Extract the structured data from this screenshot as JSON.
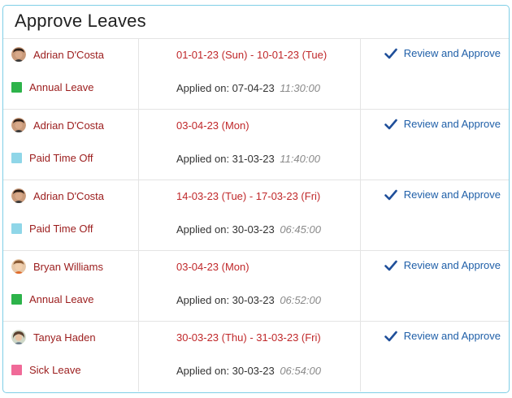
{
  "panel": {
    "title": "Approve Leaves"
  },
  "colors": {
    "annual_leave": "#2db34a",
    "paid_time_off": "#8fd6e8",
    "sick_leave": "#f06a98",
    "name_text": "#9b1c1c",
    "date_text": "#c0282a",
    "link_text": "#1f5fa8",
    "border": "#7fcfe6"
  },
  "leaves": [
    {
      "employee": "Adrian D'Costa",
      "avatar_icon": "avatar-dark-hair",
      "type": "Annual Leave",
      "type_color": "#2db34a",
      "dates": "01-01-23 (Sun) - 10-01-23 (Tue)",
      "applied_label": "Applied on: 07-04-23",
      "applied_time": "11:30:00",
      "action": "Review and Approve"
    },
    {
      "employee": "Adrian D'Costa",
      "avatar_icon": "avatar-dark-hair",
      "type": "Paid Time Off",
      "type_color": "#8fd6e8",
      "dates": "03-04-23 (Mon)",
      "applied_label": "Applied on: 31-03-23",
      "applied_time": "11:40:00",
      "action": "Review and Approve"
    },
    {
      "employee": "Adrian D'Costa",
      "avatar_icon": "avatar-dark-hair",
      "type": "Paid Time Off",
      "type_color": "#8fd6e8",
      "dates": "14-03-23 (Tue) - 17-03-23 (Fri)",
      "applied_label": "Applied on: 30-03-23",
      "applied_time": "06:45:00",
      "action": "Review and Approve"
    },
    {
      "employee": "Bryan Williams",
      "avatar_icon": "avatar-light-hair",
      "type": "Annual Leave",
      "type_color": "#2db34a",
      "dates": "03-04-23 (Mon)",
      "applied_label": "Applied on: 30-03-23",
      "applied_time": "06:52:00",
      "action": "Review and Approve"
    },
    {
      "employee": "Tanya Haden",
      "avatar_icon": "avatar-woman",
      "type": "Sick Leave",
      "type_color": "#f06a98",
      "dates": "30-03-23 (Thu) - 31-03-23 (Fri)",
      "applied_label": "Applied on: 30-03-23",
      "applied_time": "06:54:00",
      "action": "Review and Approve"
    }
  ]
}
